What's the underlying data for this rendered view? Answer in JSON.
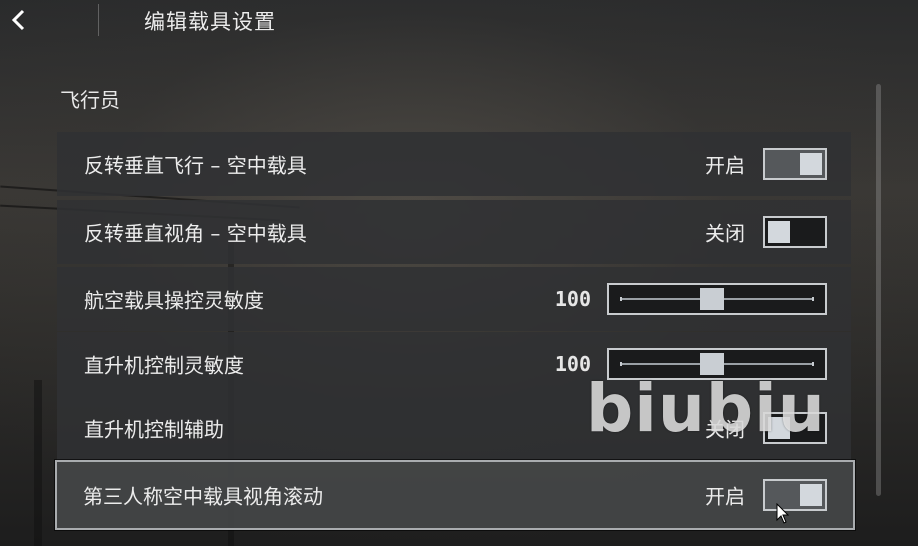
{
  "header": {
    "title": "编辑载具设置",
    "back_icon": "chevron-left-icon"
  },
  "section": {
    "title": "飞行员"
  },
  "rows": [
    {
      "label": "反转垂直飞行 – 空中载具",
      "type": "toggle",
      "state_text": "开启",
      "on": true
    },
    {
      "label": "反转垂直视角 – 空中载具",
      "type": "toggle",
      "state_text": "关闭",
      "on": false
    },
    {
      "label": "航空载具操控灵敏度",
      "type": "slider",
      "value": "100",
      "level": 0.47
    },
    {
      "label": "直升机控制灵敏度",
      "type": "slider",
      "value": "100",
      "level": 0.47
    },
    {
      "label": "直升机控制辅助",
      "type": "toggle",
      "state_text": "关闭",
      "on": false
    },
    {
      "label": "第三人称空中载具视角滚动",
      "type": "toggle",
      "state_text": "开启",
      "on": true,
      "selected": true
    }
  ],
  "watermark": "biubiu",
  "colors": {
    "row_bg": "#303133",
    "selected_border": "#a9acaf",
    "knob": "#d3d8dd"
  }
}
